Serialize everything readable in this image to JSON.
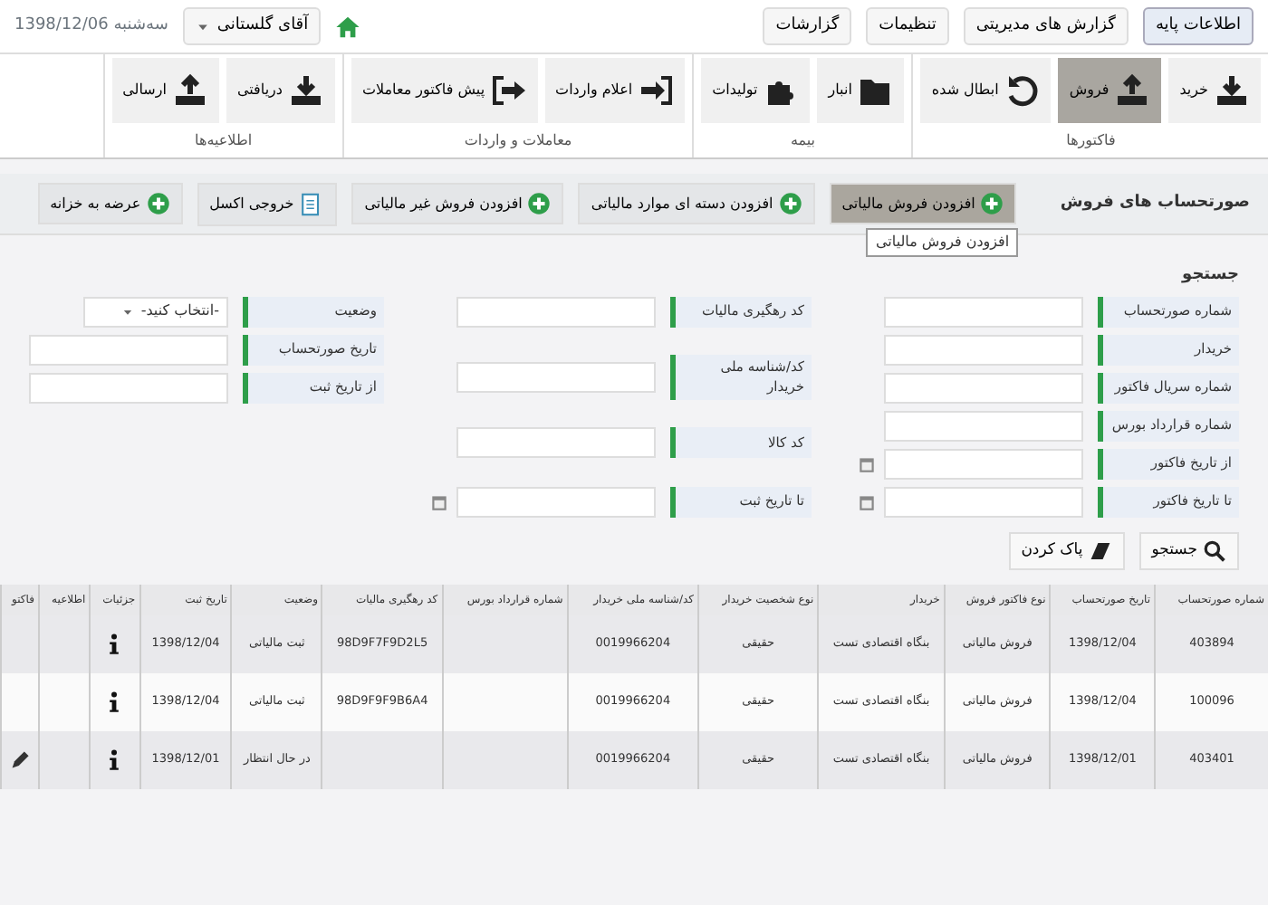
{
  "top_bar": {
    "tabs": [
      {
        "label": "اطلاعات پایه",
        "selected": true
      },
      {
        "label": "گزارش های مدیریتی",
        "selected": false
      },
      {
        "label": "تنظیمات",
        "selected": false
      },
      {
        "label": "گزارشات",
        "selected": false
      }
    ],
    "user": "آقای گلستانی",
    "date": "سه‌شنبه  1398/12/06"
  },
  "ribbon": [
    {
      "title": "فاکتورها",
      "buttons": [
        {
          "label": "خرید",
          "selected": false
        },
        {
          "label": "فروش",
          "selected": true
        },
        {
          "label": "ابطال شده",
          "selected": false
        }
      ]
    },
    {
      "title": "بیمه",
      "buttons": [
        {
          "label": "انبار",
          "selected": false
        },
        {
          "label": "تولیدات",
          "selected": false
        }
      ]
    },
    {
      "title": "معاملات و واردات",
      "buttons": [
        {
          "label": "اعلام واردات",
          "selected": false
        },
        {
          "label": "پیش فاکتور معاملات",
          "selected": false
        }
      ]
    },
    {
      "title": "اطلاعیه‌ها",
      "buttons": [
        {
          "label": "دریافتی",
          "selected": false
        },
        {
          "label": "ارسالی",
          "selected": false
        }
      ]
    }
  ],
  "section_title": "صورتحساب های فروش",
  "actions": [
    {
      "label": "افزودن فروش مالیاتی",
      "selected": true
    },
    {
      "label": "افزودن دسته ای موارد مالیاتی",
      "selected": false
    },
    {
      "label": "افزودن فروش غیر مالیاتی",
      "selected": false
    },
    {
      "label": "خروجی اکسل",
      "selected": false
    },
    {
      "label": "عرضه به خزانه",
      "selected": false
    }
  ],
  "tooltip": "افزودن فروش مالیاتی",
  "form_caption": "جستجو",
  "filters": [
    [
      {
        "label": "شماره صورتحساب",
        "kind": "text"
      },
      {
        "label": "خریدار",
        "kind": "text"
      },
      {
        "label": "شماره سریال فاکتور",
        "kind": "text"
      },
      {
        "label": "شماره قرارداد بورس",
        "kind": "text"
      },
      {
        "label": "از تاریخ فاکتور",
        "kind": "date"
      },
      {
        "label": "تا تاریخ فاکتور",
        "kind": "date"
      }
    ],
    [
      {
        "label": "کد رهگیری مالیات",
        "kind": "text"
      },
      {
        "label": "کد/شناسه ملی خریدار",
        "kind": "text"
      },
      {
        "label": "کد کالا",
        "kind": "text"
      },
      {
        "label": "تا تاریخ ثبت",
        "kind": "date"
      }
    ],
    [
      {
        "label": "وضعیت",
        "kind": "select",
        "value": "-انتخاب کنید-"
      },
      {
        "label": "تاریخ صورتحساب",
        "kind": "text"
      },
      {
        "label": "از تاریخ ثبت",
        "kind": "text"
      }
    ]
  ],
  "search_buttons": [
    "جستجو",
    "پاک کردن"
  ],
  "table": {
    "columns": [
      "شماره صورتحساب",
      "تاریخ صورتحساب",
      "نوع فاکتور فروش",
      "خریدار",
      "نوع شخصیت خریدار",
      "کد/شناسه ملی خریدار",
      "شماره قرارداد بورس",
      "کد رهگیری مالیات",
      "وضعیت",
      "تاریخ ثبت",
      "جزئیات",
      "اطلاعیه",
      "فاکتو"
    ],
    "rows": [
      {
        "cells": [
          "403894",
          "1398/12/04",
          "فروش مالیاتی",
          "بنگاه اقتصادی تست",
          "حقیقی",
          "0019966204",
          "",
          "98D9F7F9D2L5",
          "ثبت مالیاتی",
          "1398/12/04"
        ],
        "editable": false
      },
      {
        "cells": [
          "100096",
          "1398/12/04",
          "فروش مالیاتی",
          "بنگاه اقتصادی تست",
          "حقیقی",
          "0019966204",
          "",
          "98D9F9F9B6A4",
          "ثبت مالیاتی",
          "1398/12/04"
        ],
        "editable": false
      },
      {
        "cells": [
          "403401",
          "1398/12/01",
          "فروش مالیاتی",
          "بنگاه اقتصادی تست",
          "حقیقی",
          "0019966204",
          "",
          "",
          "در حال انتظار",
          "1398/12/01"
        ],
        "editable": true
      }
    ]
  }
}
